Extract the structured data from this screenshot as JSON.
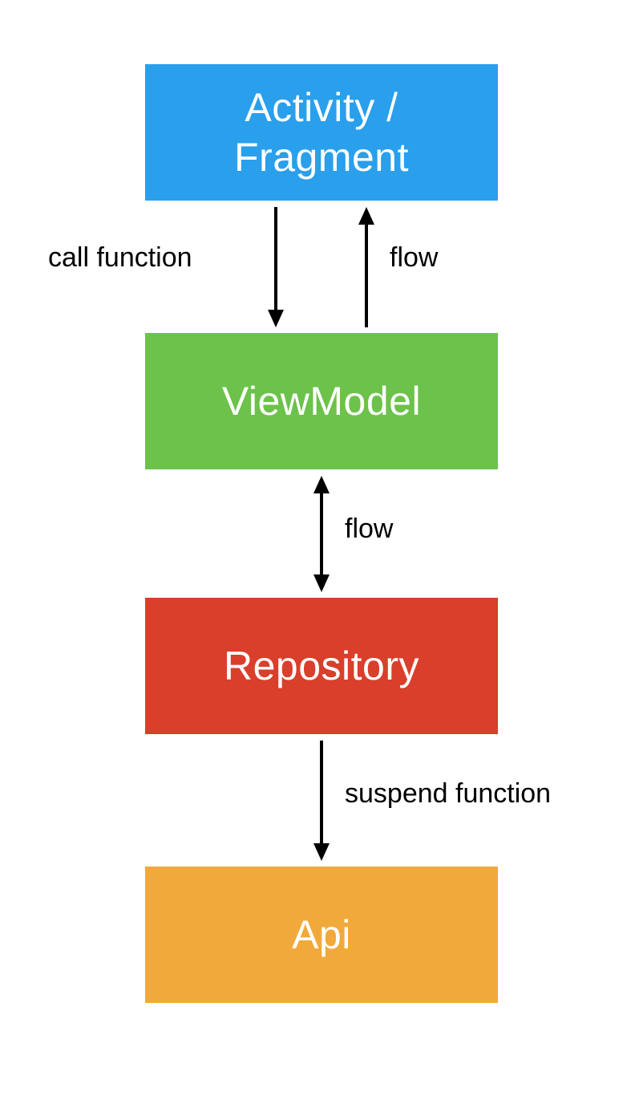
{
  "boxes": {
    "activity": {
      "label": "Activity /\nFragment",
      "color": "#2A9FEC"
    },
    "viewmodel": {
      "label": "ViewModel",
      "color": "#6CC24A"
    },
    "repository": {
      "label": "Repository",
      "color": "#D93F2B"
    },
    "api": {
      "label": "Api",
      "color": "#F2A93B"
    }
  },
  "arrows": {
    "activity_to_viewmodel_down": {
      "label": "call function"
    },
    "viewmodel_to_activity_up": {
      "label": "flow"
    },
    "viewmodel_repository_both": {
      "label": "flow"
    },
    "repository_to_api_down": {
      "label": "suspend function"
    }
  }
}
